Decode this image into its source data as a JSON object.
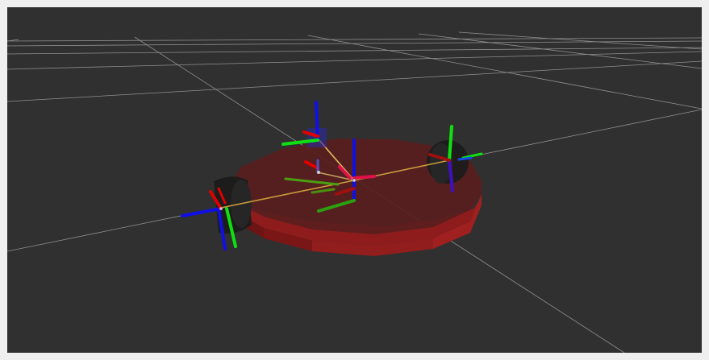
{
  "viewport": {
    "background_color": "#303030",
    "grid_color": "#a0a0a0",
    "robot_body_color": "#8a1c1c",
    "wheel_color": "#1a1a1a",
    "axis_x_color": "#e00000",
    "axis_y_color": "#10e010",
    "axis_z_color": "#1010f0",
    "link_color": "#c8a040"
  },
  "scene": {
    "objects": [
      "grid-floor",
      "robot-base-disc",
      "left-wheel",
      "right-wheel",
      "base-frame-axes",
      "left-wheel-frame-axes",
      "right-wheel-frame-axes",
      "caster-frame-axes",
      "tf-links"
    ]
  }
}
